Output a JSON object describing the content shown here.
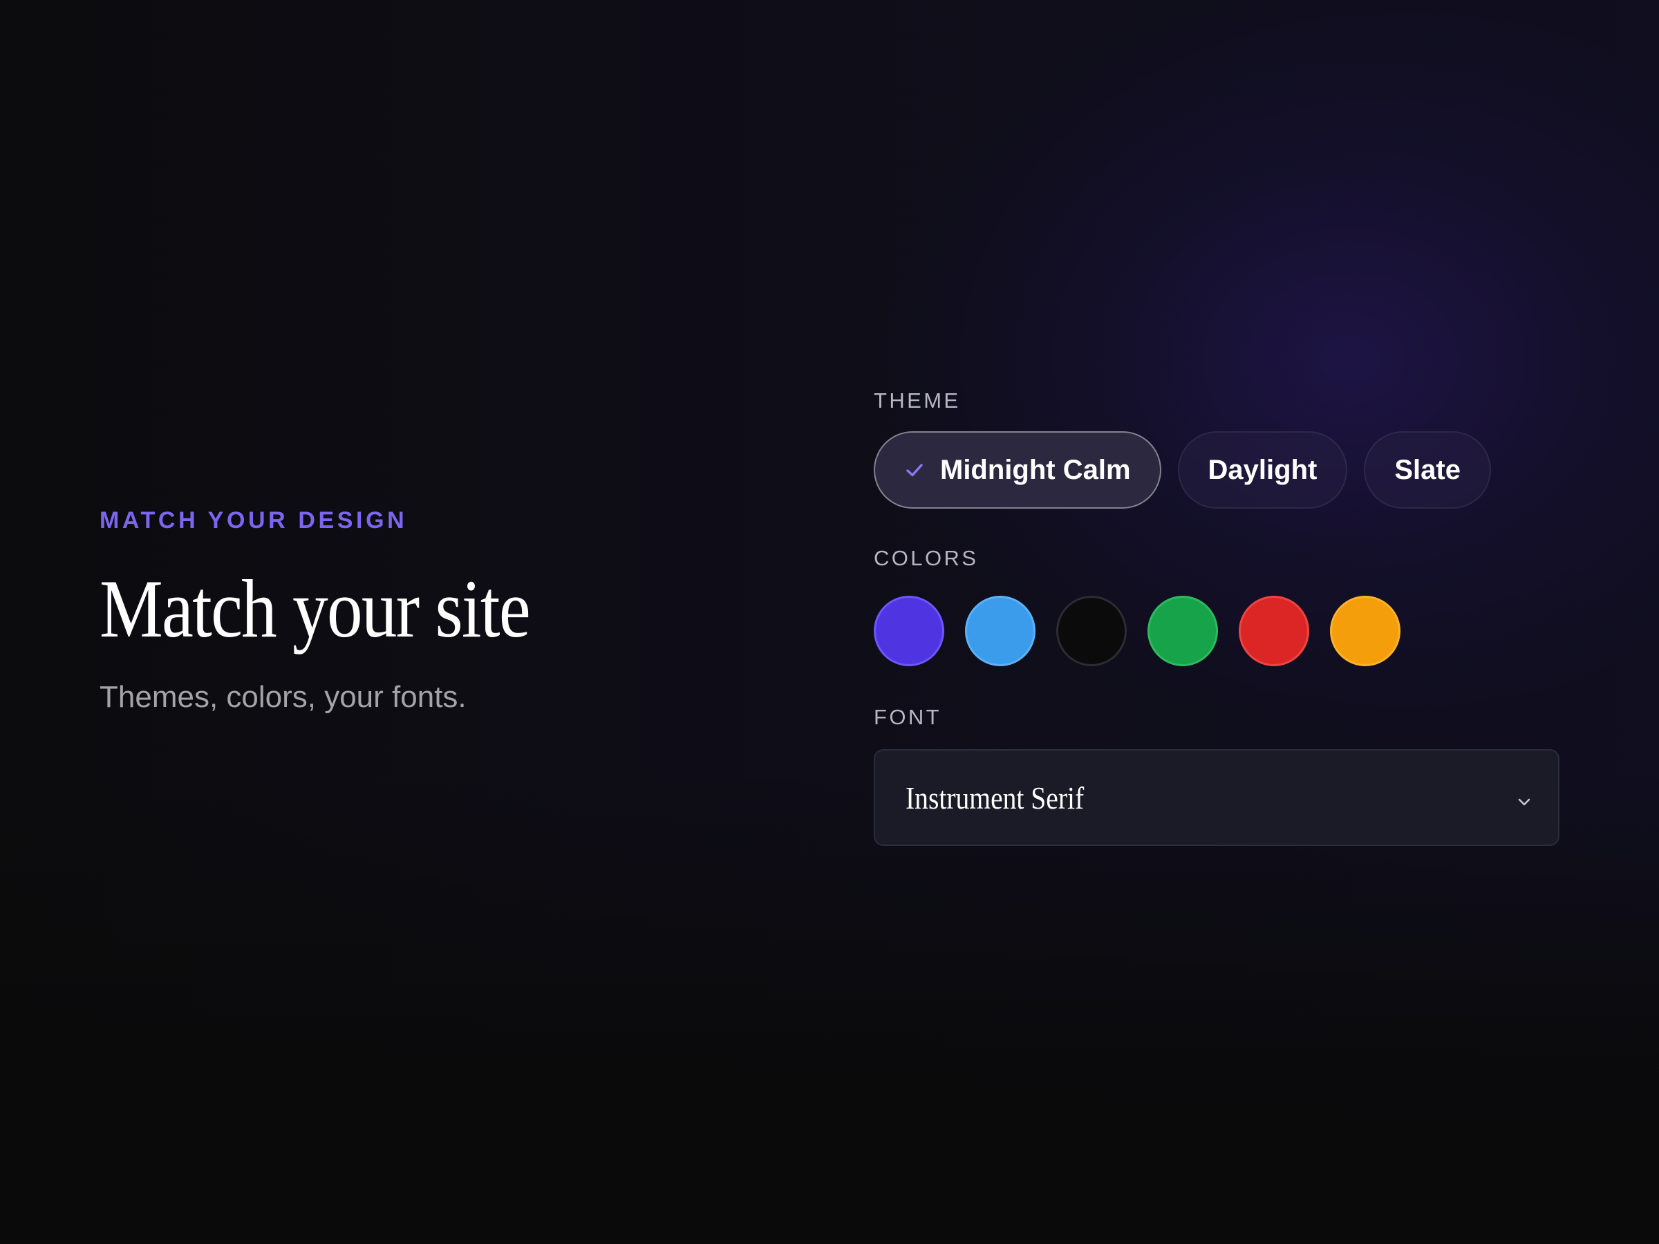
{
  "hero": {
    "eyebrow": "MATCH YOUR DESIGN",
    "title": "Match your site",
    "subtitle": "Themes, colors, your fonts."
  },
  "theme": {
    "label": "THEME",
    "selected": "Midnight Calm",
    "options": [
      {
        "label": "Midnight Calm",
        "selected": true,
        "icon": "check-icon"
      },
      {
        "label": "Daylight",
        "selected": false
      },
      {
        "label": "Slate",
        "selected": false
      }
    ]
  },
  "colors": {
    "label": "COLORS",
    "swatches": [
      {
        "name": "indigo",
        "fill": "#4f35e2",
        "border": "#6b56ff"
      },
      {
        "name": "blue",
        "fill": "#3b9cec",
        "border": "#5cb1f7"
      },
      {
        "name": "black",
        "fill": "#0b0b0c",
        "border": "#2c2c31"
      },
      {
        "name": "green",
        "fill": "#16a34a",
        "border": "#2dbb5f"
      },
      {
        "name": "red",
        "fill": "#dc2626",
        "border": "#ef4444"
      },
      {
        "name": "amber",
        "fill": "#f59e0b",
        "border": "#fbb32a"
      }
    ]
  },
  "font": {
    "label": "FONT",
    "value": "Instrument Serif",
    "icon": "chevron-down-icon"
  },
  "accent": "#7c66f0"
}
